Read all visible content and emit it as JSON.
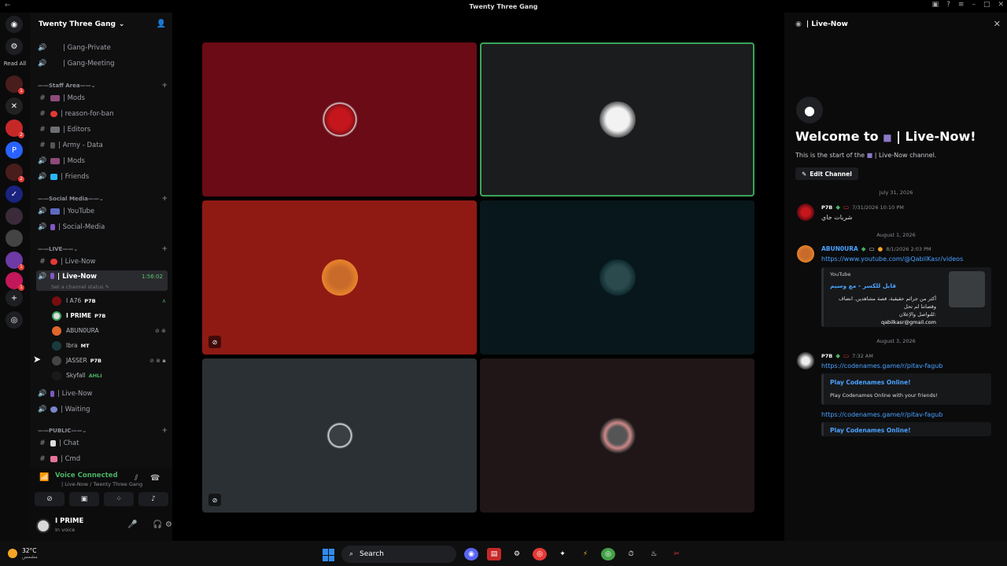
{
  "window": {
    "title": "Twenty Three Gang"
  },
  "server": {
    "name": "Twenty Three Gang",
    "read_all_label": "Read All"
  },
  "channels": {
    "gang_private": "| Gang-Private",
    "gang_meeting": "| Gang-Meeting",
    "staff_category": "Staff Area",
    "mods1": "| Mods",
    "reason_for_ban": "| reason-for-ban",
    "editors": "| Editors",
    "army_data": "| Army - Data",
    "mods2": "| Mods",
    "friends": "| Friends",
    "social_category": "Social Media",
    "youtube": "| YouTube",
    "social_media": "| Social-Media",
    "live_category": "LIVE",
    "live_now_text": "| Live-Now",
    "live_now_voice": "| Live-Now",
    "live_timer": "1:56:02",
    "channel_status": "Set a channel status",
    "live_now_voice2": "| Live-Now",
    "waiting": "| Waiting",
    "public_category": "PUBLIC",
    "chat": "| Chat",
    "cmd": "| Cmd"
  },
  "voice_users": [
    {
      "name": "I A76",
      "tag": "P7B"
    },
    {
      "name": "I PRIME",
      "tag": "P7B"
    },
    {
      "name": "ABUN0URA",
      "tag": ""
    },
    {
      "name": "Ibra",
      "tag": "MT"
    },
    {
      "name": "JASSER",
      "tag": "P7B"
    },
    {
      "name": "Skyfall",
      "tag": "AHLI"
    }
  ],
  "voice_panel": {
    "status": "Voice Connected",
    "location": "| Live-Now / Twenty Three Gang"
  },
  "user": {
    "name": "I PRIME",
    "status": "In voice"
  },
  "right_panel": {
    "header": "| Live-Now",
    "welcome_prefix": "Welcome to",
    "welcome_channel": "| Live-Now!",
    "start_prefix": "This is the start of the",
    "start_channel": "| Live-Now channel.",
    "edit_channel": "Edit Channel",
    "date1": "July 31, 2026",
    "msg1_tag": "P7B",
    "msg1_ts": "7/31/2026 10:10 PM",
    "msg1_text": "شريات جاي",
    "date2": "August 1, 2026",
    "msg2_name": "ABUN0URA",
    "msg2_ts": "8/1/2026 2:03 PM",
    "msg2_link": "https://www.youtube.com/@QabilKasr/videos",
    "embed_provider": "YouTube",
    "embed_title": "قابل للكسر - مع وسيم",
    "embed_desc1": "أكثر من جرائم حقيقية، قصة مشاهدين. انضاف",
    "embed_desc2": "وقصاتنا لم تحل",
    "embed_desc3": "للتواصل والإعلان:",
    "embed_email": "qabilkasr@gmail.com",
    "date3": "August 3, 2026",
    "msg3_tag": "P7B",
    "msg3_ts": "7:32 AM",
    "msg3_link": "https://codenames.game/r/pitav-fagub",
    "embed2_title": "Play Codenames Online!",
    "embed2_desc": "Play Codenames Online with your friends!",
    "msg3_link2": "https://codenames.game/r/pitav-fagub",
    "embed3_title": "Play Codenames Online!"
  },
  "taskbar": {
    "temp": "32°C",
    "weather_desc": "مشمس",
    "search": "Search"
  },
  "colors": {
    "speaking": "#3ba55c",
    "link": "#4aa3ff",
    "voice_green": "#4bb164"
  }
}
